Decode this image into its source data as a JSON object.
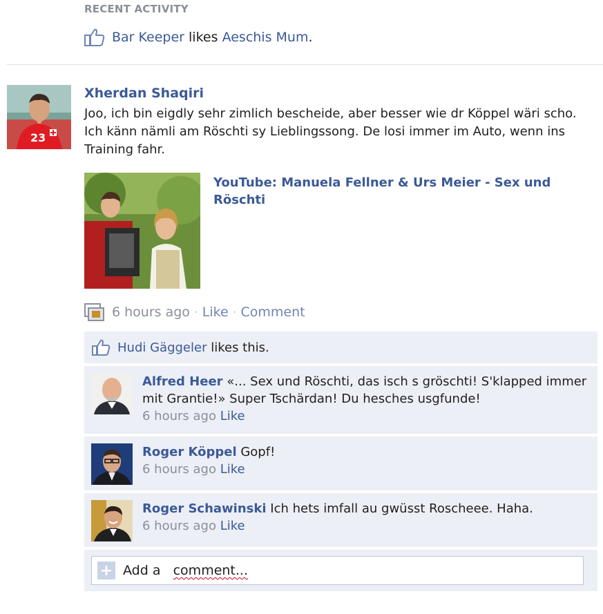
{
  "recent_activity": {
    "heading": "RECENT ACTIVITY",
    "actor": "Bar Keeper",
    "verb": "likes",
    "target": "Aeschis Mum",
    "trailing": "."
  },
  "post": {
    "author": "Xherdan Shaqiri",
    "text": "Joo, ich bin eigdly sehr zimlich bescheide, aber besser wie dr Köppel wäri scho. Ich känn nämli am Röschti sy Lieblingssong. De losi immer im Auto, wenn ins Training fahr.",
    "share_title": "YouTube: Manuela Fellner & Urs Meier - Sex und Röschti",
    "time": "6 hours ago",
    "like_label": "Like",
    "comment_label": "Comment",
    "separator": "·",
    "avatar_icon": "profile-photo",
    "share_icon": "video-thumbnail"
  },
  "feedback": {
    "liker": "Hudi Gäggeler",
    "likes_suffix": "likes this.",
    "comments": [
      {
        "name": "Alfred Heer",
        "text": "«... Sex und Röschti, das isch s gröschti! S'klapped immer mit Grantie!» Super Tschärdan! Du hesches usgfunde!",
        "time": "6 hours ago",
        "like": "Like"
      },
      {
        "name": "Roger Köppel",
        "text": "Gopf!",
        "time": "6 hours ago",
        "like": "Like"
      },
      {
        "name": "Roger Schawinski",
        "text": "Ich hets imfall au gwüsst Roscheee. Haha.",
        "time": "6 hours ago",
        "like": "Like"
      }
    ],
    "add_comment_placeholder_a": "Add a",
    "add_comment_placeholder_b": "comment..."
  },
  "colors": {
    "link": "#3b5998",
    "muted": "#8a8f99",
    "feedback_bg": "#eceff5"
  }
}
